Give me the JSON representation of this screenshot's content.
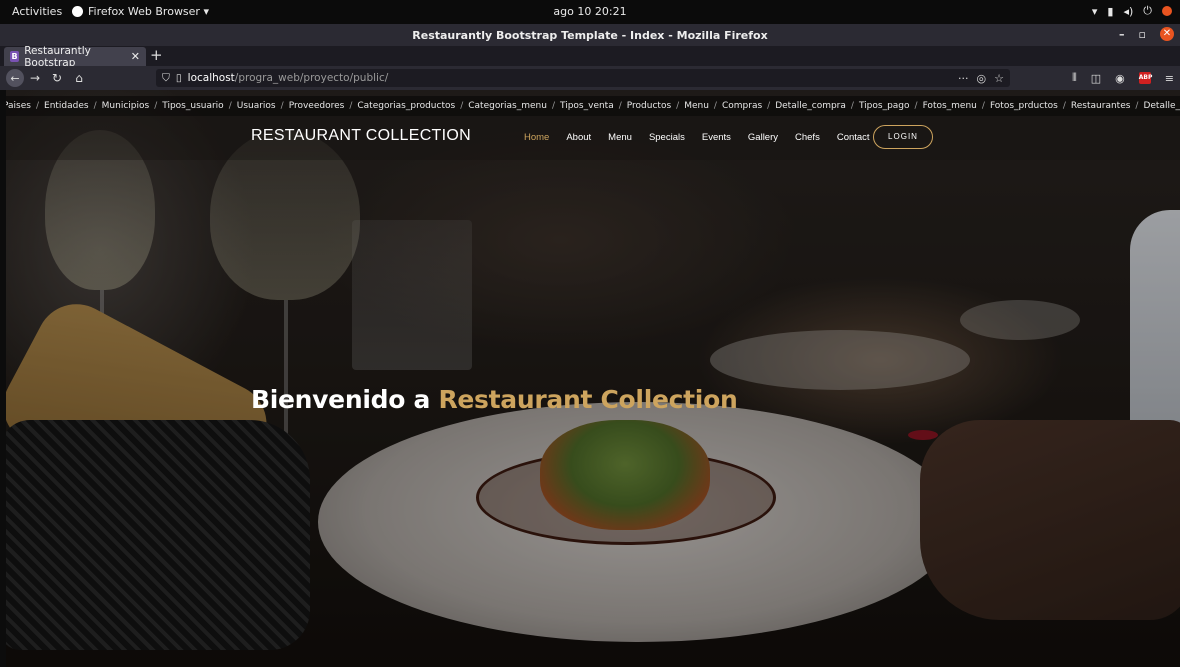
{
  "system": {
    "activities": "Activities",
    "app_name": "Firefox Web Browser ▾",
    "clock": "ago 10  20:21"
  },
  "window": {
    "title": "Restaurantly Bootstrap Template - Index - Mozilla Firefox"
  },
  "tab": {
    "favicon": "B",
    "label": "Restaurantly Bootstrap",
    "close": "✕",
    "new_tab": "+"
  },
  "urlbar": {
    "host": "localhost",
    "path": "/progra_web/proyecto/public/",
    "dots": "···"
  },
  "breadcrumbs": [
    "Paises",
    "Entidades",
    "Municipios",
    "Tipos_usuario",
    "Usuarios",
    "Proveedores",
    "Categorias_productos",
    "Categorias_menu",
    "Tipos_venta",
    "Productos",
    "Menu",
    "Compras",
    "Detalle_compra",
    "Tipos_pago",
    "Fotos_menu",
    "Fotos_prductos",
    "Restaurantes",
    "Detalle_venta"
  ],
  "site": {
    "brand": "RESTAURANT COLLECTION",
    "nav": {
      "home": "Home",
      "about": "About",
      "menu": "Menu",
      "specials": "Specials",
      "events": "Events",
      "gallery": "Gallery",
      "chefs": "Chefs",
      "contact": "Contact"
    },
    "login": "LOGIN"
  },
  "hero": {
    "prefix": "Bienvenido a ",
    "accent": "Restaurant Collection"
  },
  "colors": {
    "accent": "#cda45e",
    "ubuntu_orange": "#e95420"
  }
}
